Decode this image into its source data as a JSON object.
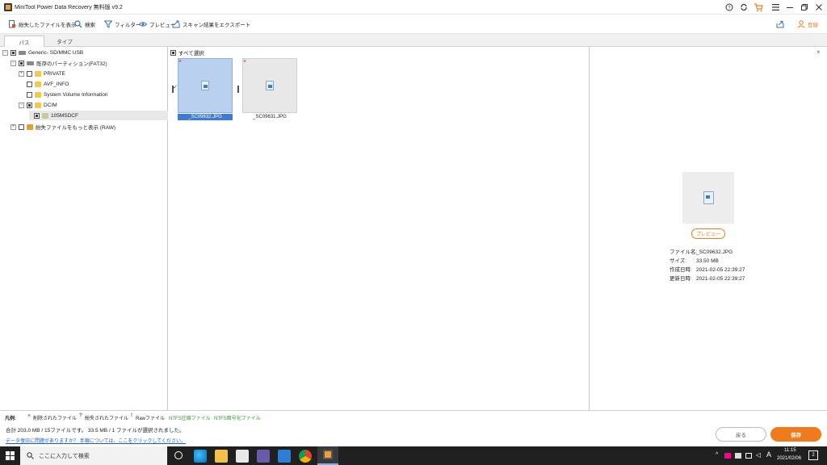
{
  "window": {
    "title": "MiniTool Power Data Recovery 無料版 v9.2"
  },
  "toolbar": {
    "show_lost": "紛失したファイルを表示",
    "search": "検索",
    "filter": "フィルター",
    "preview": "プレビュー",
    "export": "スキャン結果をエクスポート",
    "register": "登録"
  },
  "tabs": [
    "パス",
    "タイプ"
  ],
  "tree": {
    "root": "Generic- SD/MMC USB",
    "partition": "既存のパーティション(FAT32)",
    "items": [
      "PRIVATE",
      "AVF_INFO",
      "System Volume Information",
      "DCIM"
    ],
    "subfolder": "105MSDCF",
    "raw": "紛失ファイルをもっと表示 (RAW)"
  },
  "files": {
    "select_all": "すべて選択",
    "items": [
      {
        "name": "_SC09632.JPG",
        "selected": true
      },
      {
        "name": "_SC09631.JPG",
        "selected": false
      }
    ]
  },
  "preview": {
    "button": "プレビュー",
    "labels": [
      "ファイル名:",
      "サイズ:",
      "作成日時:",
      "更新日時:"
    ],
    "values": [
      "_SC09632.JPG",
      "33.50 MB",
      "2021-02-05 22:39:27",
      "2021-02-05 22:39:27"
    ]
  },
  "legend": {
    "title": "凡例:",
    "deleted": "削除されたファイル",
    "lost": "紛失されたファイル",
    "raw": "Rawファイル",
    "ntfs_compressed": "NTFS圧縮ファイル",
    "ntfs_encrypted": "NTFS暗号化ファイル"
  },
  "summary": {
    "text": "合計 203.0 MB / 15ファイルです。 33.5 MB / 1 ファイルが選択されました。",
    "link": "データ復旧に問題がありますか？ 手順については、ここをクリックしてください。",
    "back": "戻る",
    "save": "保存"
  },
  "taskbar": {
    "search_placeholder": "ここに入力して検索",
    "time": "11:15",
    "date": "2021/02/06",
    "ime": "A",
    "notifications": "2"
  },
  "colors": {
    "accent": "#f07b1d",
    "selected": "#b9d1ee",
    "taskbar": "#202020"
  }
}
